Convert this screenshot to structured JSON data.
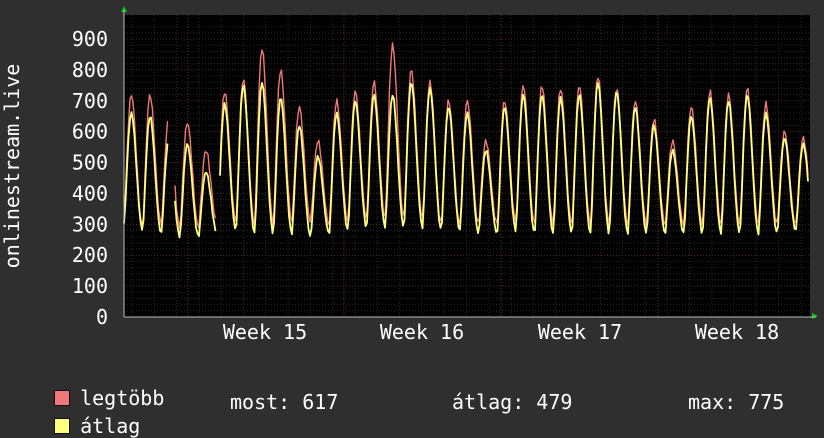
{
  "chart_data": {
    "type": "line",
    "ylabel": "onlinestream.live",
    "yticks": [
      0,
      100,
      200,
      300,
      400,
      500,
      600,
      700,
      800,
      900
    ],
    "ylim": [
      0,
      950
    ],
    "xticks": [
      "Week 15",
      "Week 16",
      "Week 17",
      "Week 18"
    ],
    "grid": true,
    "series": [
      {
        "name": "legtöbb",
        "color": "#f07878",
        "peaks": [
          720,
          720,
          640,
          630,
          540,
          730,
          770,
          870,
          800,
          680,
          570,
          700,
          730,
          760,
          880,
          800,
          760,
          700,
          700,
          570,
          700,
          750,
          750,
          740,
          750,
          780,
          740,
          700,
          640,
          570,
          680,
          730,
          720,
          740,
          690,
          600,
          580
        ],
        "troughs": [
          320,
          290,
          300,
          290,
          290,
          300,
          310,
          300,
          300,
          310,
          310,
          300,
          310,
          320,
          320,
          320,
          320,
          300,
          300,
          300,
          300,
          310,
          300,
          300,
          300,
          300,
          300,
          300,
          300,
          300,
          300,
          300,
          300,
          300,
          300,
          300,
          300
        ]
      },
      {
        "name": "átlag",
        "color": "#ffff80",
        "peaks": [
          660,
          650,
          570,
          560,
          470,
          690,
          750,
          760,
          710,
          620,
          520,
          660,
          700,
          720,
          720,
          760,
          740,
          680,
          660,
          540,
          680,
          720,
          720,
          710,
          720,
          760,
          730,
          680,
          620,
          540,
          650,
          710,
          700,
          720,
          660,
          580,
          560
        ],
        "troughs": [
          300,
          280,
          270,
          260,
          260,
          270,
          280,
          270,
          270,
          270,
          260,
          270,
          280,
          290,
          290,
          290,
          290,
          280,
          280,
          270,
          270,
          280,
          270,
          270,
          270,
          270,
          270,
          270,
          270,
          270,
          270,
          270,
          270,
          270,
          270,
          270,
          280
        ]
      }
    ]
  },
  "legend": {
    "items": [
      {
        "label": "legtöbb",
        "color": "#f07878"
      },
      {
        "label": "átlag",
        "color": "#ffff80"
      }
    ],
    "stats": {
      "most": "most: 617",
      "atlag": "átlag: 479",
      "max": "max: 775"
    }
  }
}
